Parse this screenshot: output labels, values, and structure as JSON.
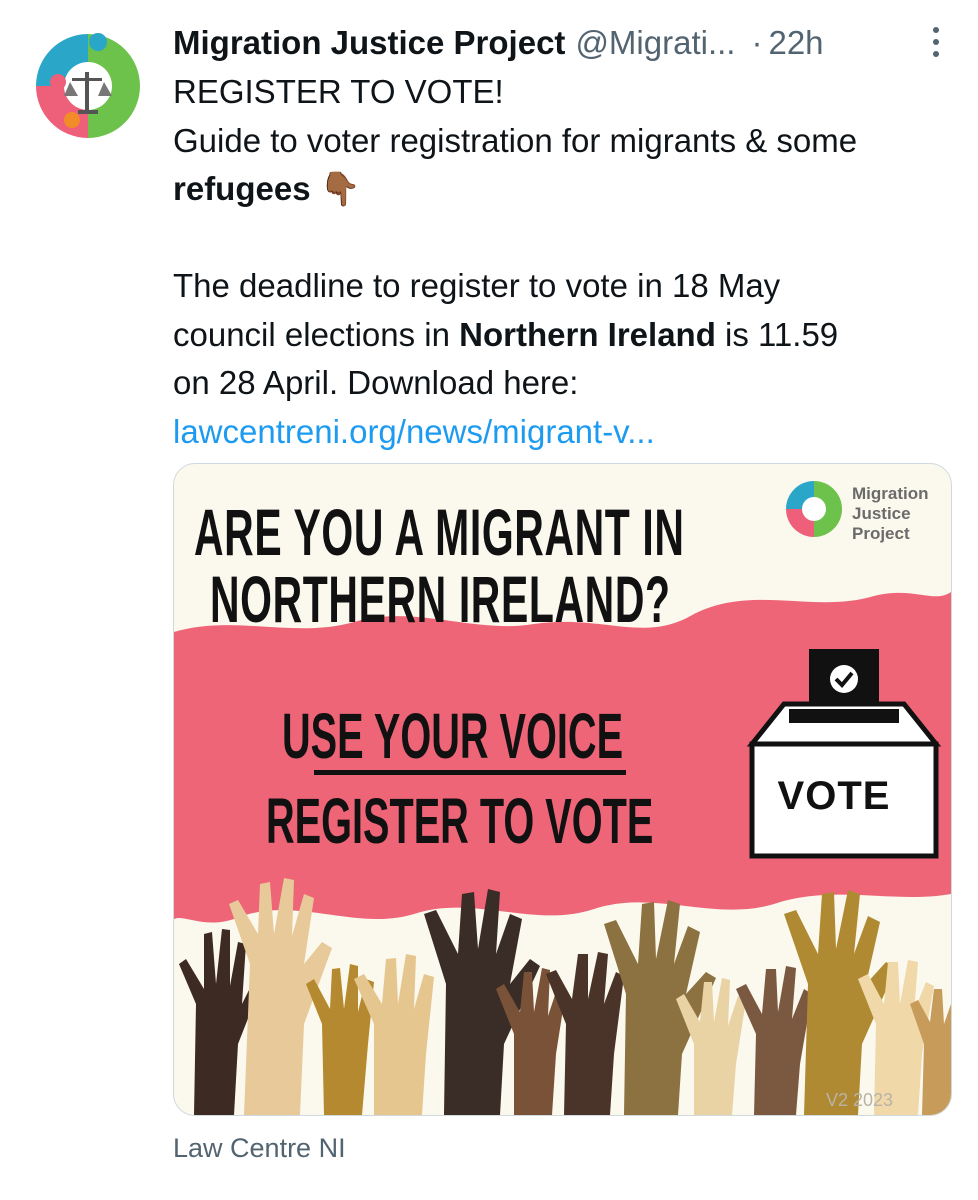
{
  "author": {
    "name": "Migration Justice Project",
    "handle": "@Migrati...",
    "separator": "·",
    "time": "22h"
  },
  "tweet": {
    "line1": "REGISTER TO VOTE!",
    "line2": "Guide to voter registration for migrants & some",
    "line3_bold": "refugees",
    "line3_emoji": "👇🏾",
    "line4": "The deadline to register to vote in 18 May",
    "line5_pre": "council elections in ",
    "line5_bold": "Northern Ireland",
    "line5_post": " is 11.59",
    "line6": "on 28 April. Download here:",
    "link": "lawcentreni.org/news/migrant-v..."
  },
  "media": {
    "heading_line1": "ARE YOU A MIGRANT IN",
    "heading_line2": "NORTHERN IRELAND?",
    "logo_line1": "Migration",
    "logo_line2": "Justice",
    "logo_line3": "Project",
    "voice_line1": "USE YOUR VOICE",
    "voice_line2": "REGISTER TO VOTE",
    "ballot_label": "VOTE",
    "version": "V2 2023"
  },
  "source": "Law Centre NI",
  "colors": {
    "pink": "#ee6578",
    "cream": "#fbf8ee",
    "link": "#1d9bf0",
    "muted": "#536471"
  }
}
